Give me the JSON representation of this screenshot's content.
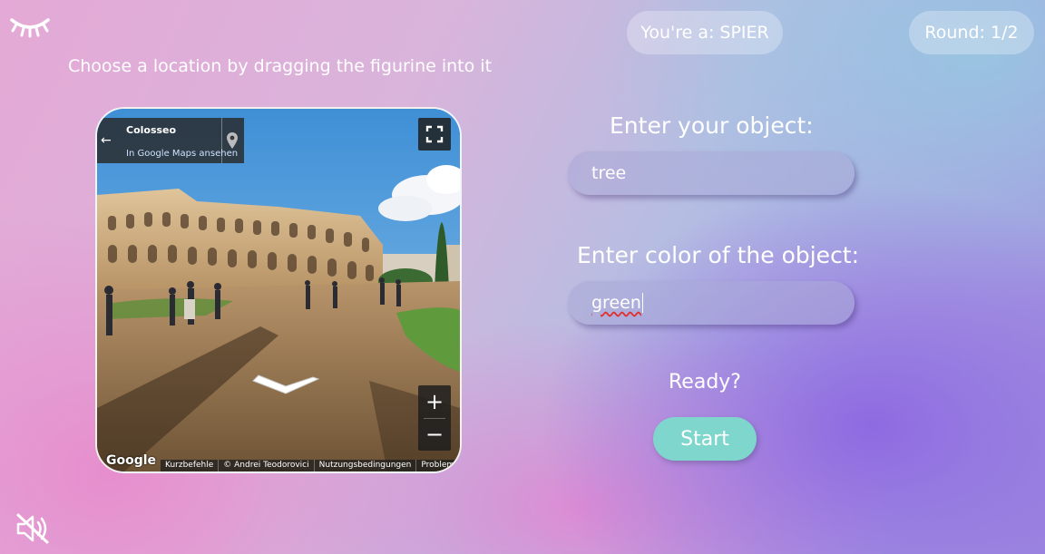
{
  "header": {
    "role_label": "You're a: SPIER",
    "round_label": "Round: 1/2"
  },
  "instruction": "Choose a location by dragging the figurine into it",
  "streetview": {
    "place_title": "Colosseo",
    "maps_link": "In Google Maps ansehen",
    "zoom_in": "+",
    "zoom_out": "−",
    "google_logo": "Google",
    "footer_links": [
      "Kurzbefehle",
      "© Andrei Teodorovici",
      "Nutzungsbedingungen",
      "Problem melden"
    ]
  },
  "form": {
    "object_label": "Enter your object:",
    "object_value": "tree",
    "color_label": "Enter color of the object:",
    "color_value": "green",
    "ready_text": "Ready?",
    "start_label": "Start"
  },
  "icons": {
    "top_left": "closed-eye-icon",
    "bottom_left": "speaker-muted-icon"
  },
  "colors": {
    "start_button": "#7fd6cd"
  }
}
